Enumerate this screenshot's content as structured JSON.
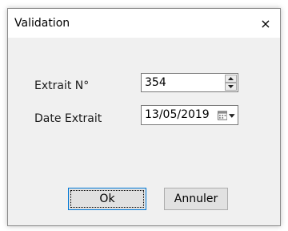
{
  "dialog": {
    "title": "Validation",
    "close_glyph": "×"
  },
  "form": {
    "extrait_label": "Extrait N°",
    "extrait_value": "354",
    "date_label": "Date Extrait",
    "date_value": "13/05/2019"
  },
  "buttons": {
    "ok_label": "Ok",
    "cancel_label": "Annuler"
  },
  "colors": {
    "accent": "#0078d7",
    "background_app_blue": "#0b6fb8"
  },
  "icons": [
    "close-icon",
    "spin-up-icon",
    "spin-down-icon",
    "calendar-icon",
    "chevron-down-icon"
  ]
}
